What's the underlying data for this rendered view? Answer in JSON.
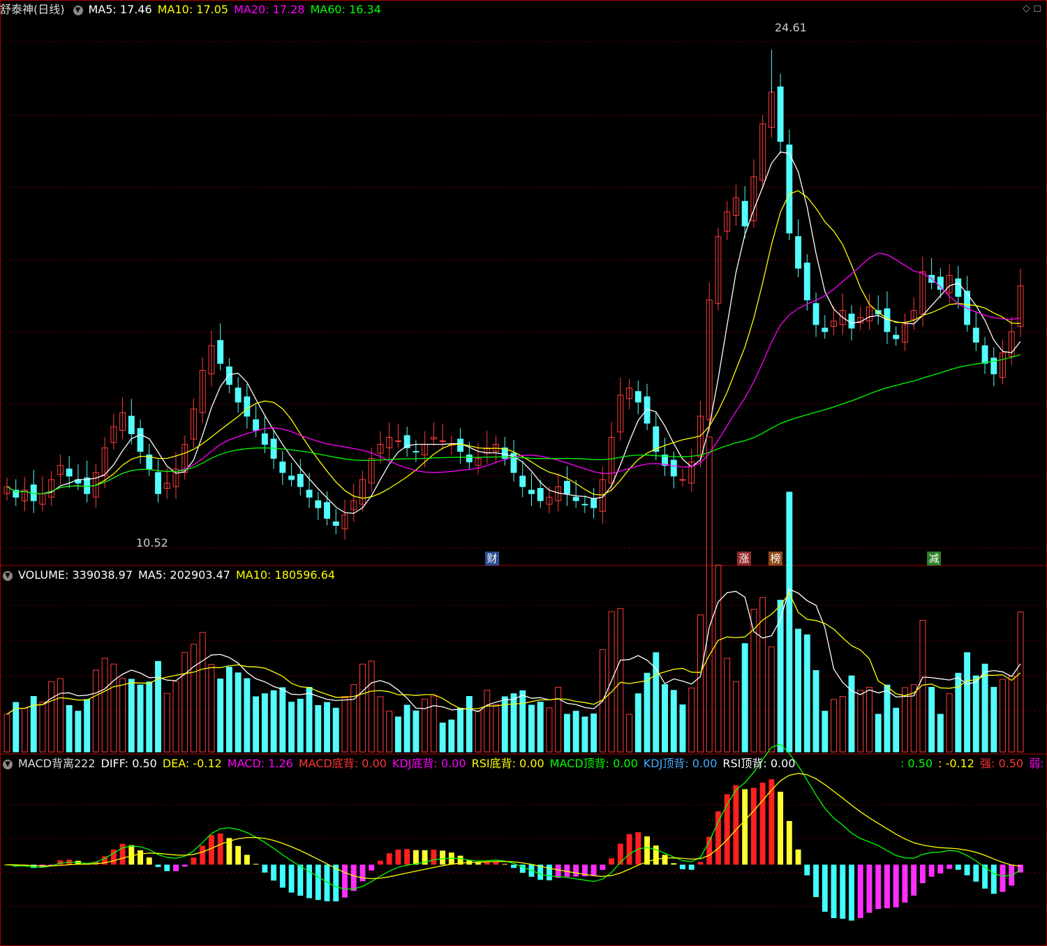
{
  "header": {
    "title": "舒泰神(日线)",
    "ma5": "MA5: 17.46",
    "ma10": "MA10: 17.05",
    "ma20": "MA20: 17.28",
    "ma60": "MA60: 16.34"
  },
  "volume_header": {
    "volume": "VOLUME: 339038.97",
    "ma5": "MA5: 202903.47",
    "ma10": "MA10: 180596.64"
  },
  "macd_header": {
    "name": "MACD背离222",
    "diff": "DIFF: 0.50",
    "dea": "DEA: -0.12",
    "macd": "MACD: 1.26",
    "macd_bottom": "MACD底背: 0.00",
    "kdj_bottom": "KDJ底背: 0.00",
    "rsi_bottom": "RSI底背: 0.00",
    "macd_top": "MACD顶背: 0.00",
    "kdj_top": "KDJ顶背: 0.00",
    "rsi_top": "RSI顶背: 0.00",
    "r1": ": 0.50",
    "r2": ": -0.12",
    "strong": "强: 0.50",
    "weak": "弱: -"
  },
  "price_labels": {
    "high": "24.61",
    "low": "10.52"
  },
  "markers": [
    {
      "text": "财",
      "color": "#2a4f8f"
    },
    {
      "text": "涨",
      "color": "#8f2a2a"
    },
    {
      "text": "榜",
      "color": "#8f4a1a"
    },
    {
      "text": "减",
      "color": "#2a7f2a"
    }
  ],
  "corner_icons": "◇ ◻",
  "colors": {
    "up": "#ff3c3c",
    "down": "#54fcfc",
    "ma5": "#ffffff",
    "ma10": "#ffff00",
    "ma20": "#ff00ff",
    "ma60": "#00ff00",
    "grid": "#7a0000",
    "border": "#b00000"
  },
  "chart_data": {
    "type": "candlestick",
    "ylim": [
      10,
      25.5
    ],
    "high": 24.61,
    "low": 10.52,
    "closes": [
      12.2,
      11.9,
      12.1,
      11.8,
      12.0,
      12.4,
      12.8,
      12.5,
      12.3,
      12.0,
      12.6,
      13.3,
      13.9,
      14.3,
      13.7,
      13.2,
      12.7,
      12.0,
      12.3,
      12.7,
      13.4,
      14.4,
      15.5,
      16.2,
      15.7,
      15.1,
      14.6,
      14.2,
      13.8,
      13.4,
      13.0,
      12.6,
      12.4,
      12.2,
      11.9,
      11.6,
      11.3,
      11.1,
      11.4,
      11.8,
      12.4,
      13.0,
      13.4,
      13.6,
      13.5,
      13.3,
      13.2,
      13.4,
      13.6,
      13.5,
      13.4,
      13.2,
      12.9,
      13.0,
      13.3,
      13.4,
      13.0,
      12.6,
      12.2,
      12.0,
      11.8,
      11.9,
      12.2,
      12.0,
      11.8,
      11.7,
      11.6,
      12.4,
      13.6,
      14.8,
      15.0,
      14.6,
      14.0,
      13.2,
      12.8,
      12.5,
      12.4,
      12.9,
      14.2,
      17.5,
      19.3,
      20.0,
      20.4,
      19.6,
      21.0,
      22.5,
      23.4,
      22.0,
      19.4,
      18.4,
      17.5,
      16.8,
      16.6,
      16.9,
      17.2,
      16.7,
      17.0,
      17.3,
      17.1,
      16.6,
      16.4,
      16.8,
      17.2,
      18.3,
      18.0,
      17.8,
      18.2,
      17.6,
      16.8,
      16.3,
      15.7,
      15.4,
      16.0,
      16.6,
      17.9
    ],
    "volume": {
      "ylim": [
        0,
        500000
      ]
    },
    "macd": {
      "ylim": [
        -1.6,
        1.9
      ]
    }
  }
}
